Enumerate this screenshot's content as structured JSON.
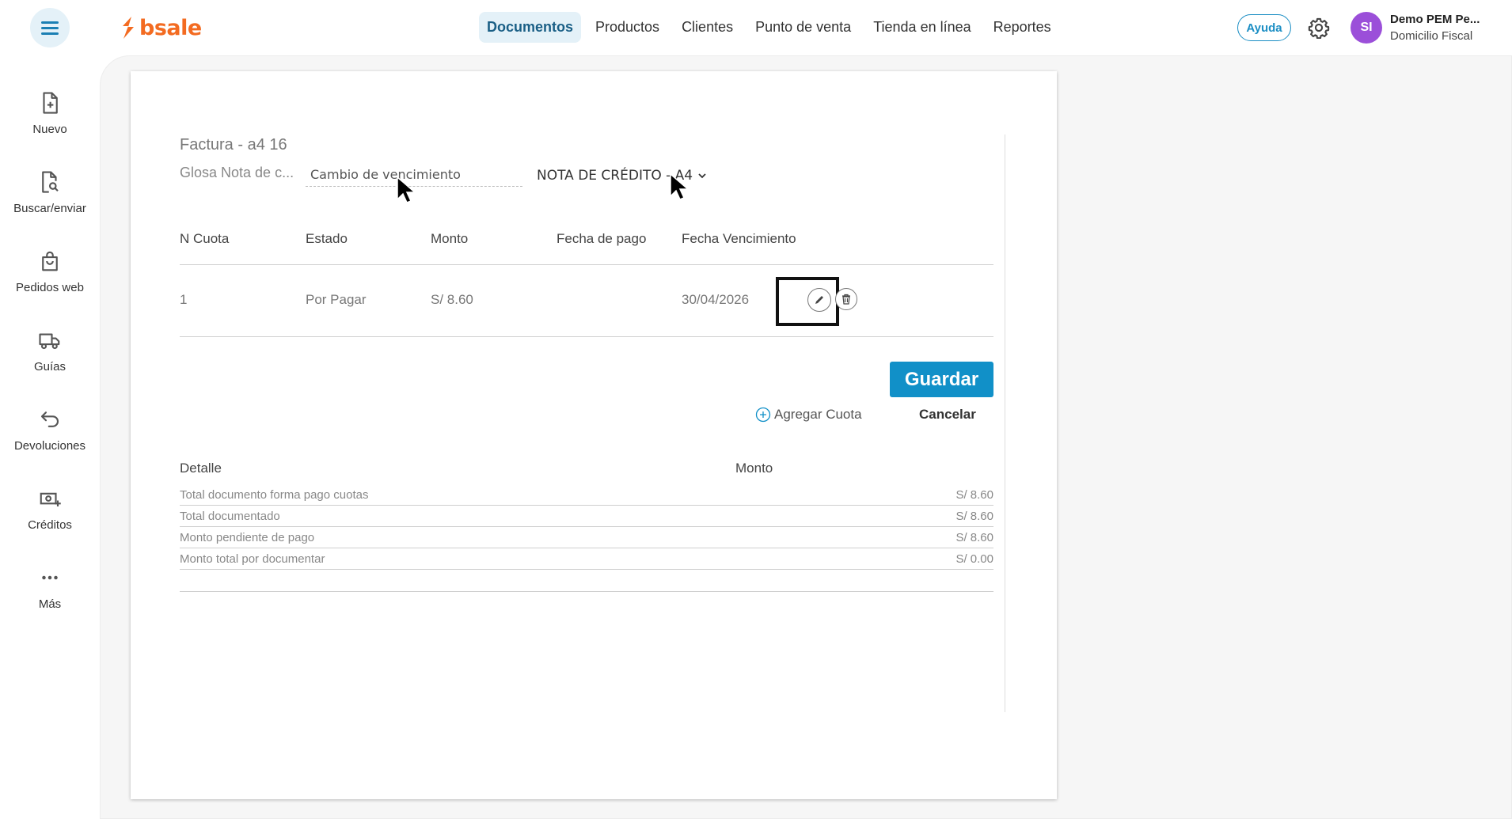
{
  "header": {
    "brand": "bsale",
    "nav": [
      {
        "label": "Documentos",
        "active": true
      },
      {
        "label": "Productos"
      },
      {
        "label": "Clientes"
      },
      {
        "label": "Punto de venta"
      },
      {
        "label": "Tienda en línea"
      },
      {
        "label": "Reportes"
      }
    ],
    "help_label": "Ayuda",
    "user": {
      "initials": "SI",
      "name": "Demo PEM Pe...",
      "subtitle": "Domicilio Fiscal"
    }
  },
  "sidebar": {
    "items": [
      {
        "label": "Nuevo",
        "icon": "file-plus-icon"
      },
      {
        "label": "Buscar/enviar",
        "icon": "file-search-icon"
      },
      {
        "label": "Pedidos web",
        "icon": "shopping-bag-icon"
      },
      {
        "label": "Guías",
        "icon": "truck-icon"
      },
      {
        "label": "Devoluciones",
        "icon": "undo-icon"
      },
      {
        "label": "Créditos",
        "icon": "money-plus-icon"
      },
      {
        "label": "Más",
        "icon": "more-dots-icon"
      }
    ]
  },
  "document": {
    "title": "Factura - a4 16",
    "glosa_label": "Glosa Nota de c...",
    "glosa_value": "Cambio de vencimiento",
    "nota_type": "NOTA DE CRÉDITO - A4",
    "table": {
      "headers": [
        "N Cuota",
        "Estado",
        "Monto",
        "Fecha de pago",
        "Fecha Vencimiento"
      ],
      "rows": [
        {
          "n": "1",
          "estado": "Por Pagar",
          "monto": "S/ 8.60",
          "fecha_pago": "",
          "fecha_venc": "30/04/2026"
        }
      ]
    },
    "save_label": "Guardar",
    "add_cuota_label": "Agregar Cuota",
    "cancel_label": "Cancelar",
    "detail": {
      "header_left": "Detalle",
      "header_right": "Monto",
      "rows": [
        {
          "label": "Total documento forma pago cuotas",
          "value": "S/ 8.60"
        },
        {
          "label": "Total documentado",
          "value": "S/ 8.60"
        },
        {
          "label": "Monto pendiente de pago",
          "value": "S/ 8.60"
        },
        {
          "label": "Monto total por documentar",
          "value": "S/ 0.00"
        }
      ]
    }
  },
  "colors": {
    "brand": "#f36b21",
    "accent": "#1190c8",
    "avatar": "#9b4fd9"
  }
}
